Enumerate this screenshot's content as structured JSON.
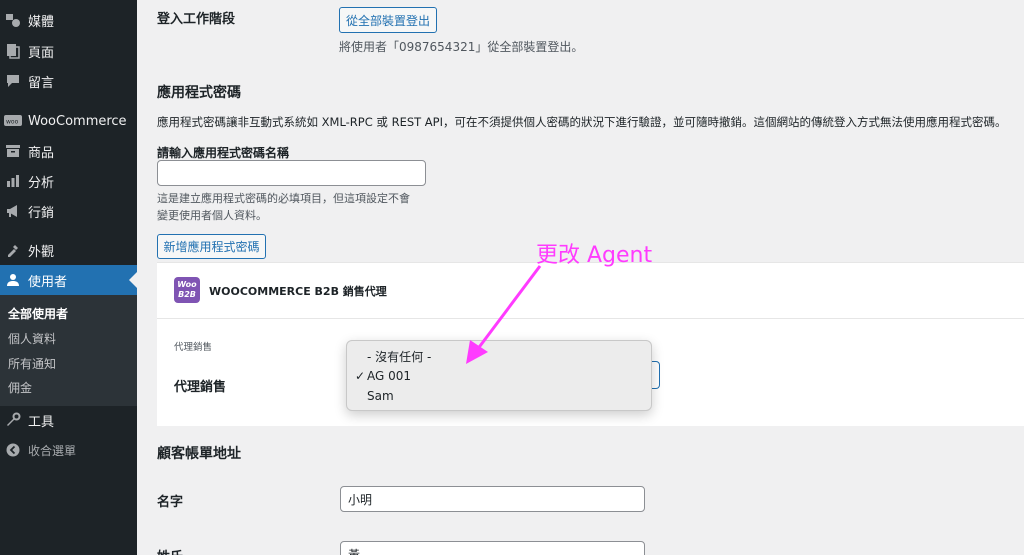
{
  "sidebar": {
    "items": [
      {
        "label": "媒體",
        "icon": "media-icon"
      },
      {
        "label": "頁面",
        "icon": "page-icon"
      },
      {
        "label": "留言",
        "icon": "comment-icon"
      },
      {
        "label": "WooCommerce",
        "icon": "woocommerce-icon"
      },
      {
        "label": "商品",
        "icon": "product-icon"
      },
      {
        "label": "分析",
        "icon": "analytics-icon"
      },
      {
        "label": "行銷",
        "icon": "marketing-icon"
      },
      {
        "label": "外觀",
        "icon": "appearance-icon"
      },
      {
        "label": "使用者",
        "icon": "user-icon"
      },
      {
        "label": "工具",
        "icon": "tools-icon"
      },
      {
        "label": "收合選單",
        "icon": "collapse-icon"
      }
    ],
    "submenu": [
      "全部使用者",
      "個人資料",
      "所有通知",
      "佣金"
    ]
  },
  "sessions": {
    "label": "登入工作階段",
    "button": "從全部裝置登出",
    "description": "將使用者「0987654321」從全部裝置登出。"
  },
  "app_passwords": {
    "title": "應用程式密碼",
    "description": "應用程式密碼讓非互動式系統如 XML-RPC 或 REST API，可在不須提供個人密碼的狀況下進行驗證，並可隨時撤銷。這個網站的傳統登入方式無法使用應用程式密碼。",
    "name_label": "請輸入應用程式密碼名稱",
    "name_value": "",
    "help_line1": "這是建立應用程式密碼的必填項目，但這項設定不會",
    "help_line2": "變更使用者個人資料。",
    "add_button": "新增應用程式密碼"
  },
  "b2b": {
    "logo_line1": "Woo",
    "logo_line2": "B2B",
    "title": "WOOCOMMERCE B2B 銷售代理",
    "small_label": "代理銷售",
    "field_label": "代理銷售",
    "options": [
      "- 沒有任何 -",
      "AG 001",
      "Sam"
    ],
    "selected": "AG 001"
  },
  "annotation": "更改 Agent",
  "billing": {
    "title": "顧客帳單地址",
    "first_name_label": "名字",
    "first_name_value": "小明",
    "last_name_label": "姓氏",
    "last_name_value": "黃"
  },
  "colors": {
    "accent": "#2271b1",
    "sidebar_bg": "#1d2327",
    "annotation": "#ff3bff",
    "logo": "#7f54b3"
  }
}
